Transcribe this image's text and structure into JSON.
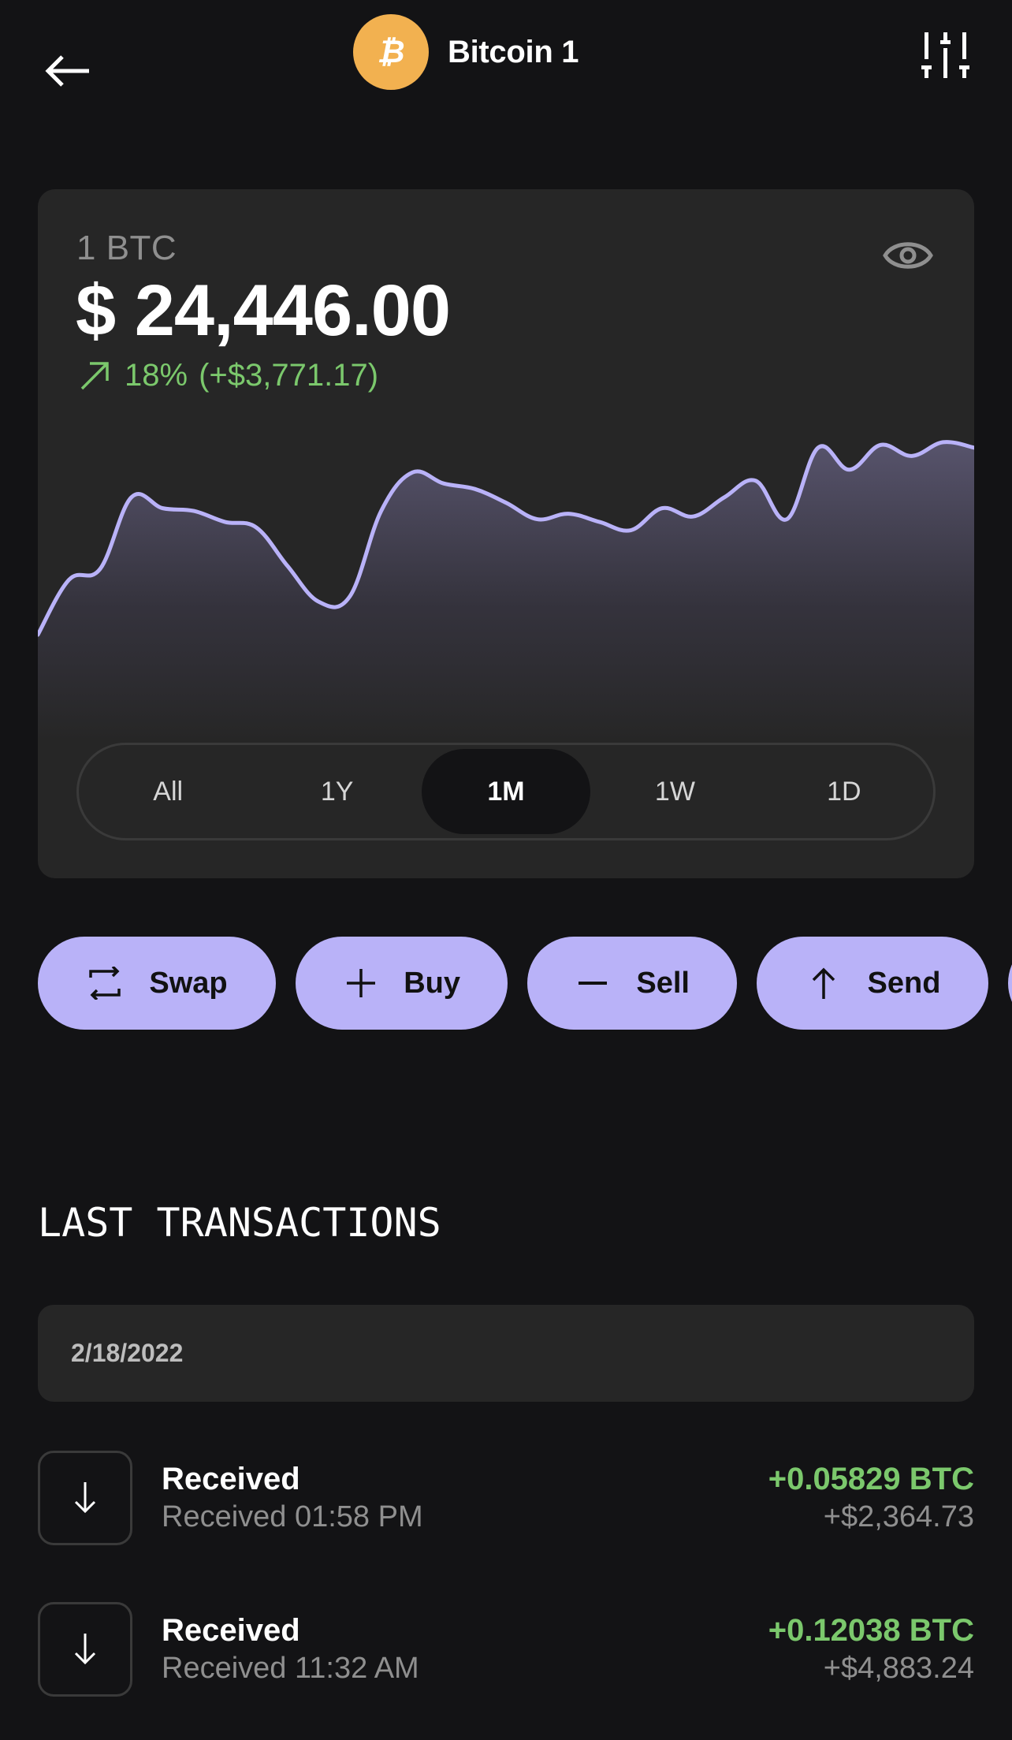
{
  "header": {
    "title": "Bitcoin 1",
    "coin_symbol_glyph": "₿",
    "back_icon": "arrow-left-icon",
    "settings_icon": "sliders-icon",
    "coin_color": "#F2B150"
  },
  "balance_card": {
    "unit": "1 BTC",
    "balance": "$ 24,446.00",
    "change_percent": "18%",
    "change_amount": "(+$3,771.17)",
    "change_direction": "up",
    "visibility_icon": "eye-icon",
    "positive_color": "#7BC86C"
  },
  "chart_data": {
    "type": "area",
    "title": "",
    "xlabel": "",
    "ylabel": "",
    "period": "1M",
    "line_color": "#B9B2F8",
    "grid": false,
    "x": [
      0,
      1,
      2,
      3,
      4,
      5,
      6,
      7,
      8,
      9,
      10,
      11,
      12,
      13,
      14,
      15,
      16,
      17,
      18,
      19,
      20,
      21,
      22,
      23,
      24,
      25,
      26,
      27,
      28,
      29,
      30
    ],
    "values": [
      100,
      120,
      124,
      150,
      146,
      145,
      141,
      139,
      125,
      112,
      114,
      145,
      159,
      155,
      153,
      148,
      142,
      144,
      141,
      138,
      146,
      143,
      150,
      156,
      142,
      168,
      160,
      169,
      165,
      170,
      168
    ],
    "ylim": [
      90,
      180
    ]
  },
  "range_tabs": {
    "items": [
      {
        "label": "All",
        "active": false
      },
      {
        "label": "1Y",
        "active": false
      },
      {
        "label": "1M",
        "active": true
      },
      {
        "label": "1W",
        "active": false
      },
      {
        "label": "1D",
        "active": false
      }
    ]
  },
  "actions": {
    "items": [
      {
        "label": "Swap",
        "icon": "swap-icon"
      },
      {
        "label": "Buy",
        "icon": "plus-icon"
      },
      {
        "label": "Sell",
        "icon": "minus-icon"
      },
      {
        "label": "Send",
        "icon": "arrow-up-icon"
      }
    ],
    "accent_color": "#B9B2F8"
  },
  "transactions": {
    "section_title": "LAST TRANSACTIONS",
    "groups": [
      {
        "date": "2/18/2022",
        "items": [
          {
            "title": "Received",
            "subtitle": "Received 01:58 PM",
            "amount_btc": "+0.05829 BTC",
            "amount_usd": "+$2,364.73",
            "icon": "arrow-down-icon"
          },
          {
            "title": "Received",
            "subtitle": "Received 11:32 AM",
            "amount_btc": "+0.12038 BTC",
            "amount_usd": "+$4,883.24",
            "icon": "arrow-down-icon"
          }
        ]
      }
    ]
  }
}
